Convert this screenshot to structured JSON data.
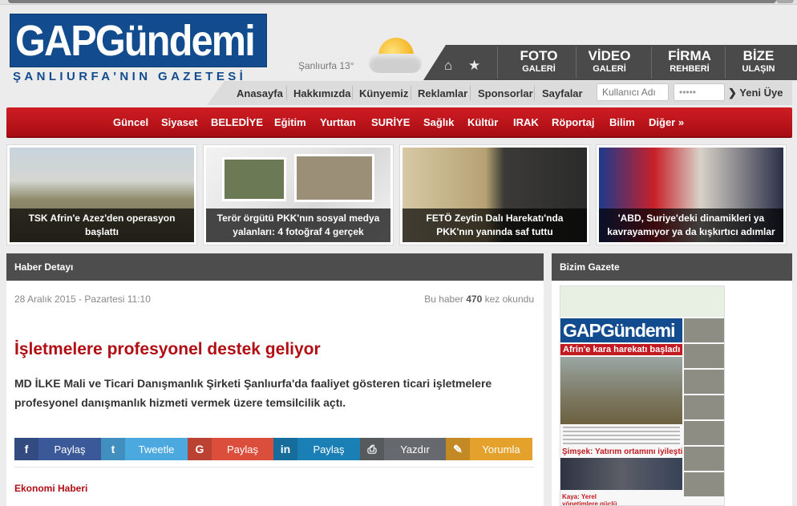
{
  "brand": {
    "logo": "GAPGündemi",
    "tagline": "ŞANLIURFA'NIN GAZETESİ"
  },
  "weather": {
    "text": "Şanlıurfa 13°"
  },
  "top_tabs": [
    {
      "big": "FOTO",
      "small": "GALERİ"
    },
    {
      "big": "VİDEO",
      "small": "GALERİ"
    },
    {
      "big": "FİRMA",
      "small": "REHBERİ"
    },
    {
      "big": "BİZE",
      "small": "ULAŞIN"
    }
  ],
  "subnav": {
    "links": [
      "Anasayfa",
      "Hakkımızda",
      "Künyemiz",
      "Reklamlar",
      "Sponsorlar",
      "Sayfalar"
    ],
    "username_placeholder": "Kullanıcı Adı",
    "password_value": "•••••",
    "new_user": "Yeni Üye"
  },
  "main_nav": [
    "Güncel",
    "Siyaset",
    "BELEDİYE",
    "Eğitim",
    "Yurttan",
    "SURİYE",
    "Sağlık",
    "Kültür",
    "IRAK",
    "Röportaj",
    "Bilim",
    "Diğer »"
  ],
  "slides": [
    {
      "caption": "TSK Afrin'e Azez'den operasyon başlattı"
    },
    {
      "caption": "Terör örgütü PKK'nın sosyal medya yalanları: 4 fotoğraf 4 gerçek"
    },
    {
      "caption": "FETÖ Zeytin Dalı Harekatı'nda PKK'nın yanında saf tuttu"
    },
    {
      "caption": "'ABD, Suriye'deki dinamikleri ya kavrayamıyor ya da kışkırtıcı adımlar"
    }
  ],
  "article": {
    "panel_title": "Haber Detayı",
    "date": "28 Aralık 2015 - Pazartesi 11:10",
    "reads_prefix": "Bu haber",
    "reads_count": "470",
    "reads_suffix": "kez okundu",
    "title": "İşletmelere profesyonel destek geliyor",
    "summary": "MD İLKE Mali ve Ticari Danışmanlık Şirketi Şanlıurfa'da faaliyet gösteren ticari işletmelere profesyonel danışmanlık hizmeti vermek üzere temsilcilik açtı.",
    "share": [
      {
        "label": "Paylaş",
        "icon": "facebook-icon",
        "color": "#3b5998"
      },
      {
        "label": "Tweetle",
        "icon": "twitter-icon",
        "color": "#4ca9e0"
      },
      {
        "label": "Paylaş",
        "icon": "google-plus-icon",
        "color": "#dc4e3c"
      },
      {
        "label": "Paylaş",
        "icon": "linkedin-icon",
        "color": "#1a7fb5"
      },
      {
        "label": "Yazdır",
        "icon": "print-icon",
        "color": "#666a6e"
      },
      {
        "label": "Yorumla",
        "icon": "comment-icon",
        "color": "#e4a22c"
      }
    ],
    "category": "Ekonomi Haberi"
  },
  "sidebar": {
    "panel_title": "Bizim Gazete",
    "paper_masthead": "GAPGündemi",
    "paper_headline": "Afrin'e kara harekatı başladı",
    "paper_headline2": "Şimşek: Yatırım ortamını iyileştiriyoruz",
    "paper_headline3": "Kaya: Yerel yönetimlere güçlü bir destek sunuluyor"
  },
  "colors": {
    "brand_blue": "#124c8e",
    "brand_red": "#c11a20",
    "nav_dark": "#4a4a4a"
  }
}
